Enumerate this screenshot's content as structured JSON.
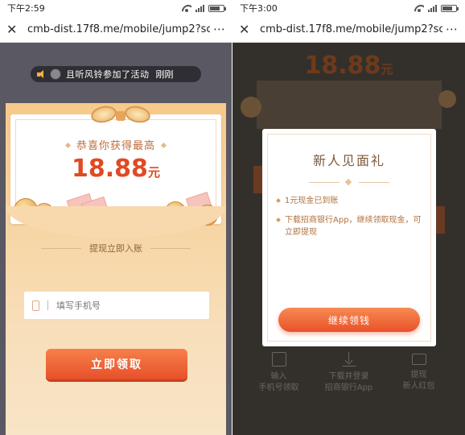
{
  "left": {
    "status": {
      "time": "下午2:59"
    },
    "urlbar": {
      "url": "cmb-dist.17f8.me/mobile/jump2?sce...",
      "menu": "⋯"
    },
    "ticker": {
      "text": "且听风铃参加了活动",
      "time": "刚刚"
    },
    "card": {
      "congrats": "恭喜你获得最高",
      "amount": "18.88",
      "unit": "元"
    },
    "tip": "提现立即入账",
    "phone": {
      "placeholder": "填写手机号"
    },
    "cta": "立即领取"
  },
  "right": {
    "status": {
      "time": "下午3:00"
    },
    "urlbar": {
      "url": "cmb-dist.17f8.me/mobile/jump2?sce...",
      "menu": "⋯"
    },
    "background": {
      "amount": "18.88",
      "unit": "元"
    },
    "modal": {
      "title": "新人见面礼",
      "items": [
        "1元现金已到账",
        "下载招商银行App，继续领取现金，可立即提现"
      ],
      "button": "继续领钱"
    },
    "steps": [
      {
        "icon": "phone-icon",
        "line1": "输入",
        "line2": "手机号领取"
      },
      {
        "icon": "download-icon",
        "line1": "下载并登录",
        "line2": "招商银行App"
      },
      {
        "icon": "envelope-icon",
        "line1": "提现",
        "line2": "新人红包"
      }
    ]
  },
  "colors": {
    "accent": "#e6502a",
    "amount": "#e04a22",
    "envelope": "#f7c98a"
  }
}
